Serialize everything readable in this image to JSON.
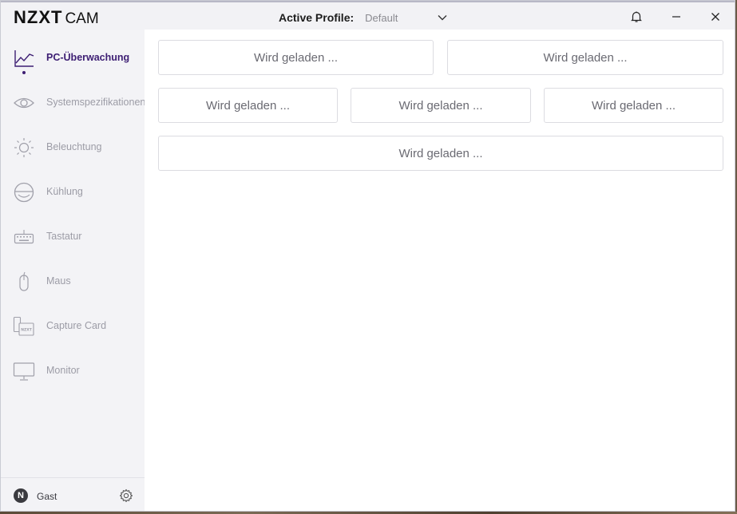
{
  "titlebar": {
    "brand": "NZXT",
    "product": "CAM",
    "profile_label": "Active Profile:",
    "profile_value": "Default"
  },
  "sidebar": {
    "items": [
      {
        "label": "PC-Überwachung",
        "icon": "line-chart-icon",
        "active": true
      },
      {
        "label": "Systemspezifikationen",
        "icon": "eye-icon",
        "active": false
      },
      {
        "label": "Beleuchtung",
        "icon": "sun-icon",
        "active": false
      },
      {
        "label": "Kühlung",
        "icon": "cooler-icon",
        "active": false
      },
      {
        "label": "Tastatur",
        "icon": "keyboard-icon",
        "active": false
      },
      {
        "label": "Maus",
        "icon": "mouse-icon",
        "active": false
      },
      {
        "label": "Capture Card",
        "icon": "capture-card-icon",
        "active": false
      },
      {
        "label": "Monitor",
        "icon": "monitor-icon",
        "active": false
      }
    ],
    "user": {
      "initial": "N",
      "name": "Gast"
    }
  },
  "main": {
    "cards": [
      {
        "label": "Wird geladen ..."
      },
      {
        "label": "Wird geladen ..."
      },
      {
        "label": "Wird geladen ..."
      },
      {
        "label": "Wird geladen ..."
      },
      {
        "label": "Wird geladen ..."
      },
      {
        "label": "Wird geladen ..."
      }
    ]
  },
  "colors": {
    "accent": "#3d1e73",
    "sidebar_bg": "#f3f3f6",
    "inactive_text": "#9c9ca6"
  }
}
